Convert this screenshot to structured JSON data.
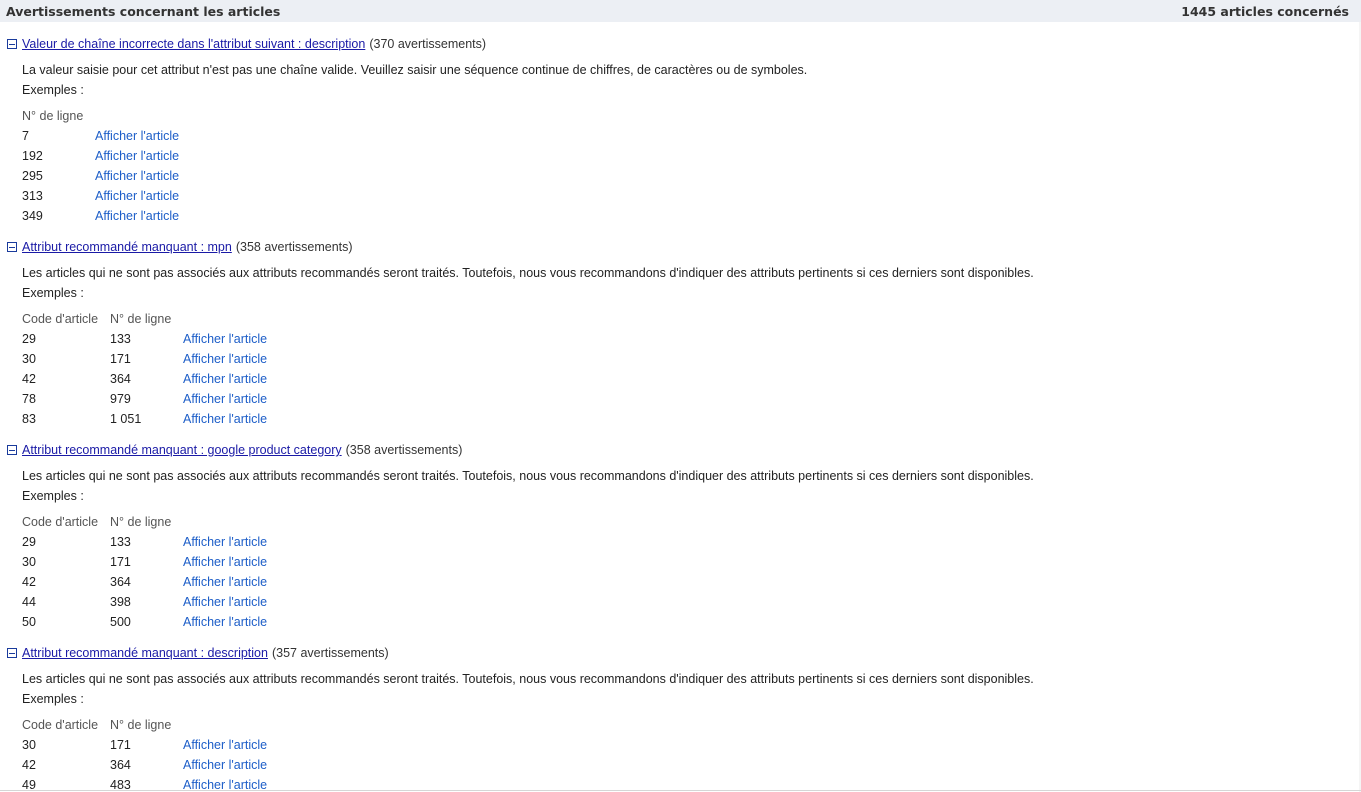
{
  "header": {
    "title": "Avertissements concernant les articles",
    "count": "1445 articles concernés"
  },
  "common": {
    "examples_label": "Exemples :",
    "col_item_code": "Code d'article",
    "col_line_no": "N° de ligne",
    "view_link": "Afficher l'article"
  },
  "sections": [
    {
      "title": "Valeur de chaîne incorrecte dans l'attribut suivant : description",
      "count": "(370 avertissements)",
      "desc": "La valeur saisie pour cet attribut n'est pas une chaîne valide. Veuillez saisir une séquence continue de chiffres, de caractères ou de symboles.",
      "rows": [
        {
          "line": "7"
        },
        {
          "line": "192"
        },
        {
          "line": "295"
        },
        {
          "line": "313"
        },
        {
          "line": "349"
        }
      ]
    },
    {
      "title": "Attribut recommandé manquant : mpn",
      "count": "(358 avertissements)",
      "desc": "Les articles qui ne sont pas associés aux attributs recommandés seront traités. Toutefois, nous vous recommandons d'indiquer des attributs pertinents si ces derniers sont disponibles.",
      "rows": [
        {
          "code": "29",
          "line": "133"
        },
        {
          "code": "30",
          "line": "171"
        },
        {
          "code": "42",
          "line": "364"
        },
        {
          "code": "78",
          "line": "979"
        },
        {
          "code": "83",
          "line": "1 051"
        }
      ]
    },
    {
      "title": "Attribut recommandé manquant : google product category",
      "count": "(358 avertissements)",
      "desc": "Les articles qui ne sont pas associés aux attributs recommandés seront traités. Toutefois, nous vous recommandons d'indiquer des attributs pertinents si ces derniers sont disponibles.",
      "rows": [
        {
          "code": "29",
          "line": "133"
        },
        {
          "code": "30",
          "line": "171"
        },
        {
          "code": "42",
          "line": "364"
        },
        {
          "code": "44",
          "line": "398"
        },
        {
          "code": "50",
          "line": "500"
        }
      ]
    },
    {
      "title": "Attribut recommandé manquant : description",
      "count": "(357 avertissements)",
      "desc": "Les articles qui ne sont pas associés aux attributs recommandés seront traités. Toutefois, nous vous recommandons d'indiquer des attributs pertinents si ces derniers sont disponibles.",
      "rows": [
        {
          "code": "30",
          "line": "171"
        },
        {
          "code": "42",
          "line": "364"
        },
        {
          "code": "49",
          "line": "483"
        }
      ]
    }
  ]
}
